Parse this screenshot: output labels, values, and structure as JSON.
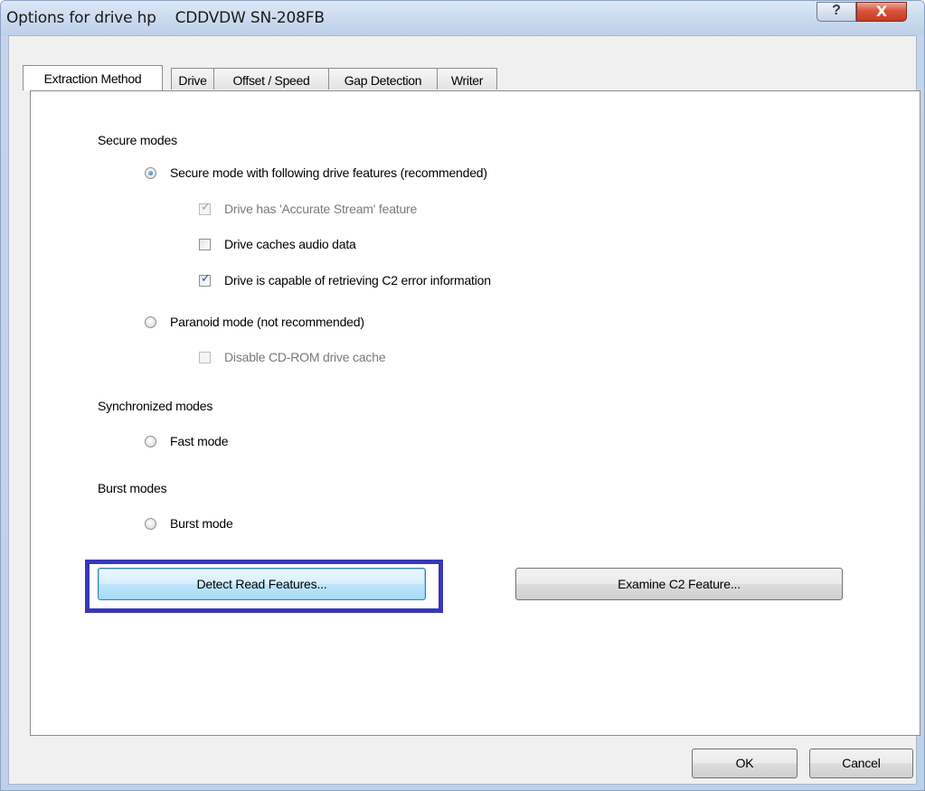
{
  "window": {
    "title": "Options for drive hp    CDDVDW SN-208FB",
    "help_glyph": "?",
    "close_glyph": "X"
  },
  "tabs": [
    {
      "label": "Extraction Method",
      "active": true
    },
    {
      "label": "Drive",
      "active": false
    },
    {
      "label": "Offset / Speed",
      "active": false
    },
    {
      "label": "Gap Detection",
      "active": false
    },
    {
      "label": "Writer",
      "active": false
    }
  ],
  "secure_modes": {
    "heading": "Secure modes",
    "secure_radio": {
      "label": "Secure mode with following drive features (recommended)",
      "selected": true
    },
    "accurate_stream": {
      "label": "Drive has 'Accurate Stream' feature",
      "checked": true,
      "enabled": false
    },
    "caches_audio": {
      "label": "Drive caches audio data",
      "checked": false,
      "enabled": true
    },
    "c2_error": {
      "label": "Drive is capable of retrieving C2 error information",
      "checked": true,
      "enabled": true
    },
    "paranoid_radio": {
      "label": "Paranoid mode (not recommended)",
      "selected": false
    },
    "disable_cache": {
      "label": "Disable CD-ROM drive cache",
      "checked": false,
      "enabled": false
    }
  },
  "synchronized_modes": {
    "heading": "Synchronized modes",
    "fast_radio": {
      "label": "Fast mode",
      "selected": false
    }
  },
  "burst_modes": {
    "heading": "Burst modes",
    "burst_radio": {
      "label": "Burst mode",
      "selected": false
    }
  },
  "buttons": {
    "detect": "Detect Read Features...",
    "examine": "Examine C2 Feature...",
    "ok": "OK",
    "cancel": "Cancel"
  },
  "colors": {
    "highlight_border": "#3838b8",
    "close_button": "#c73a22"
  }
}
